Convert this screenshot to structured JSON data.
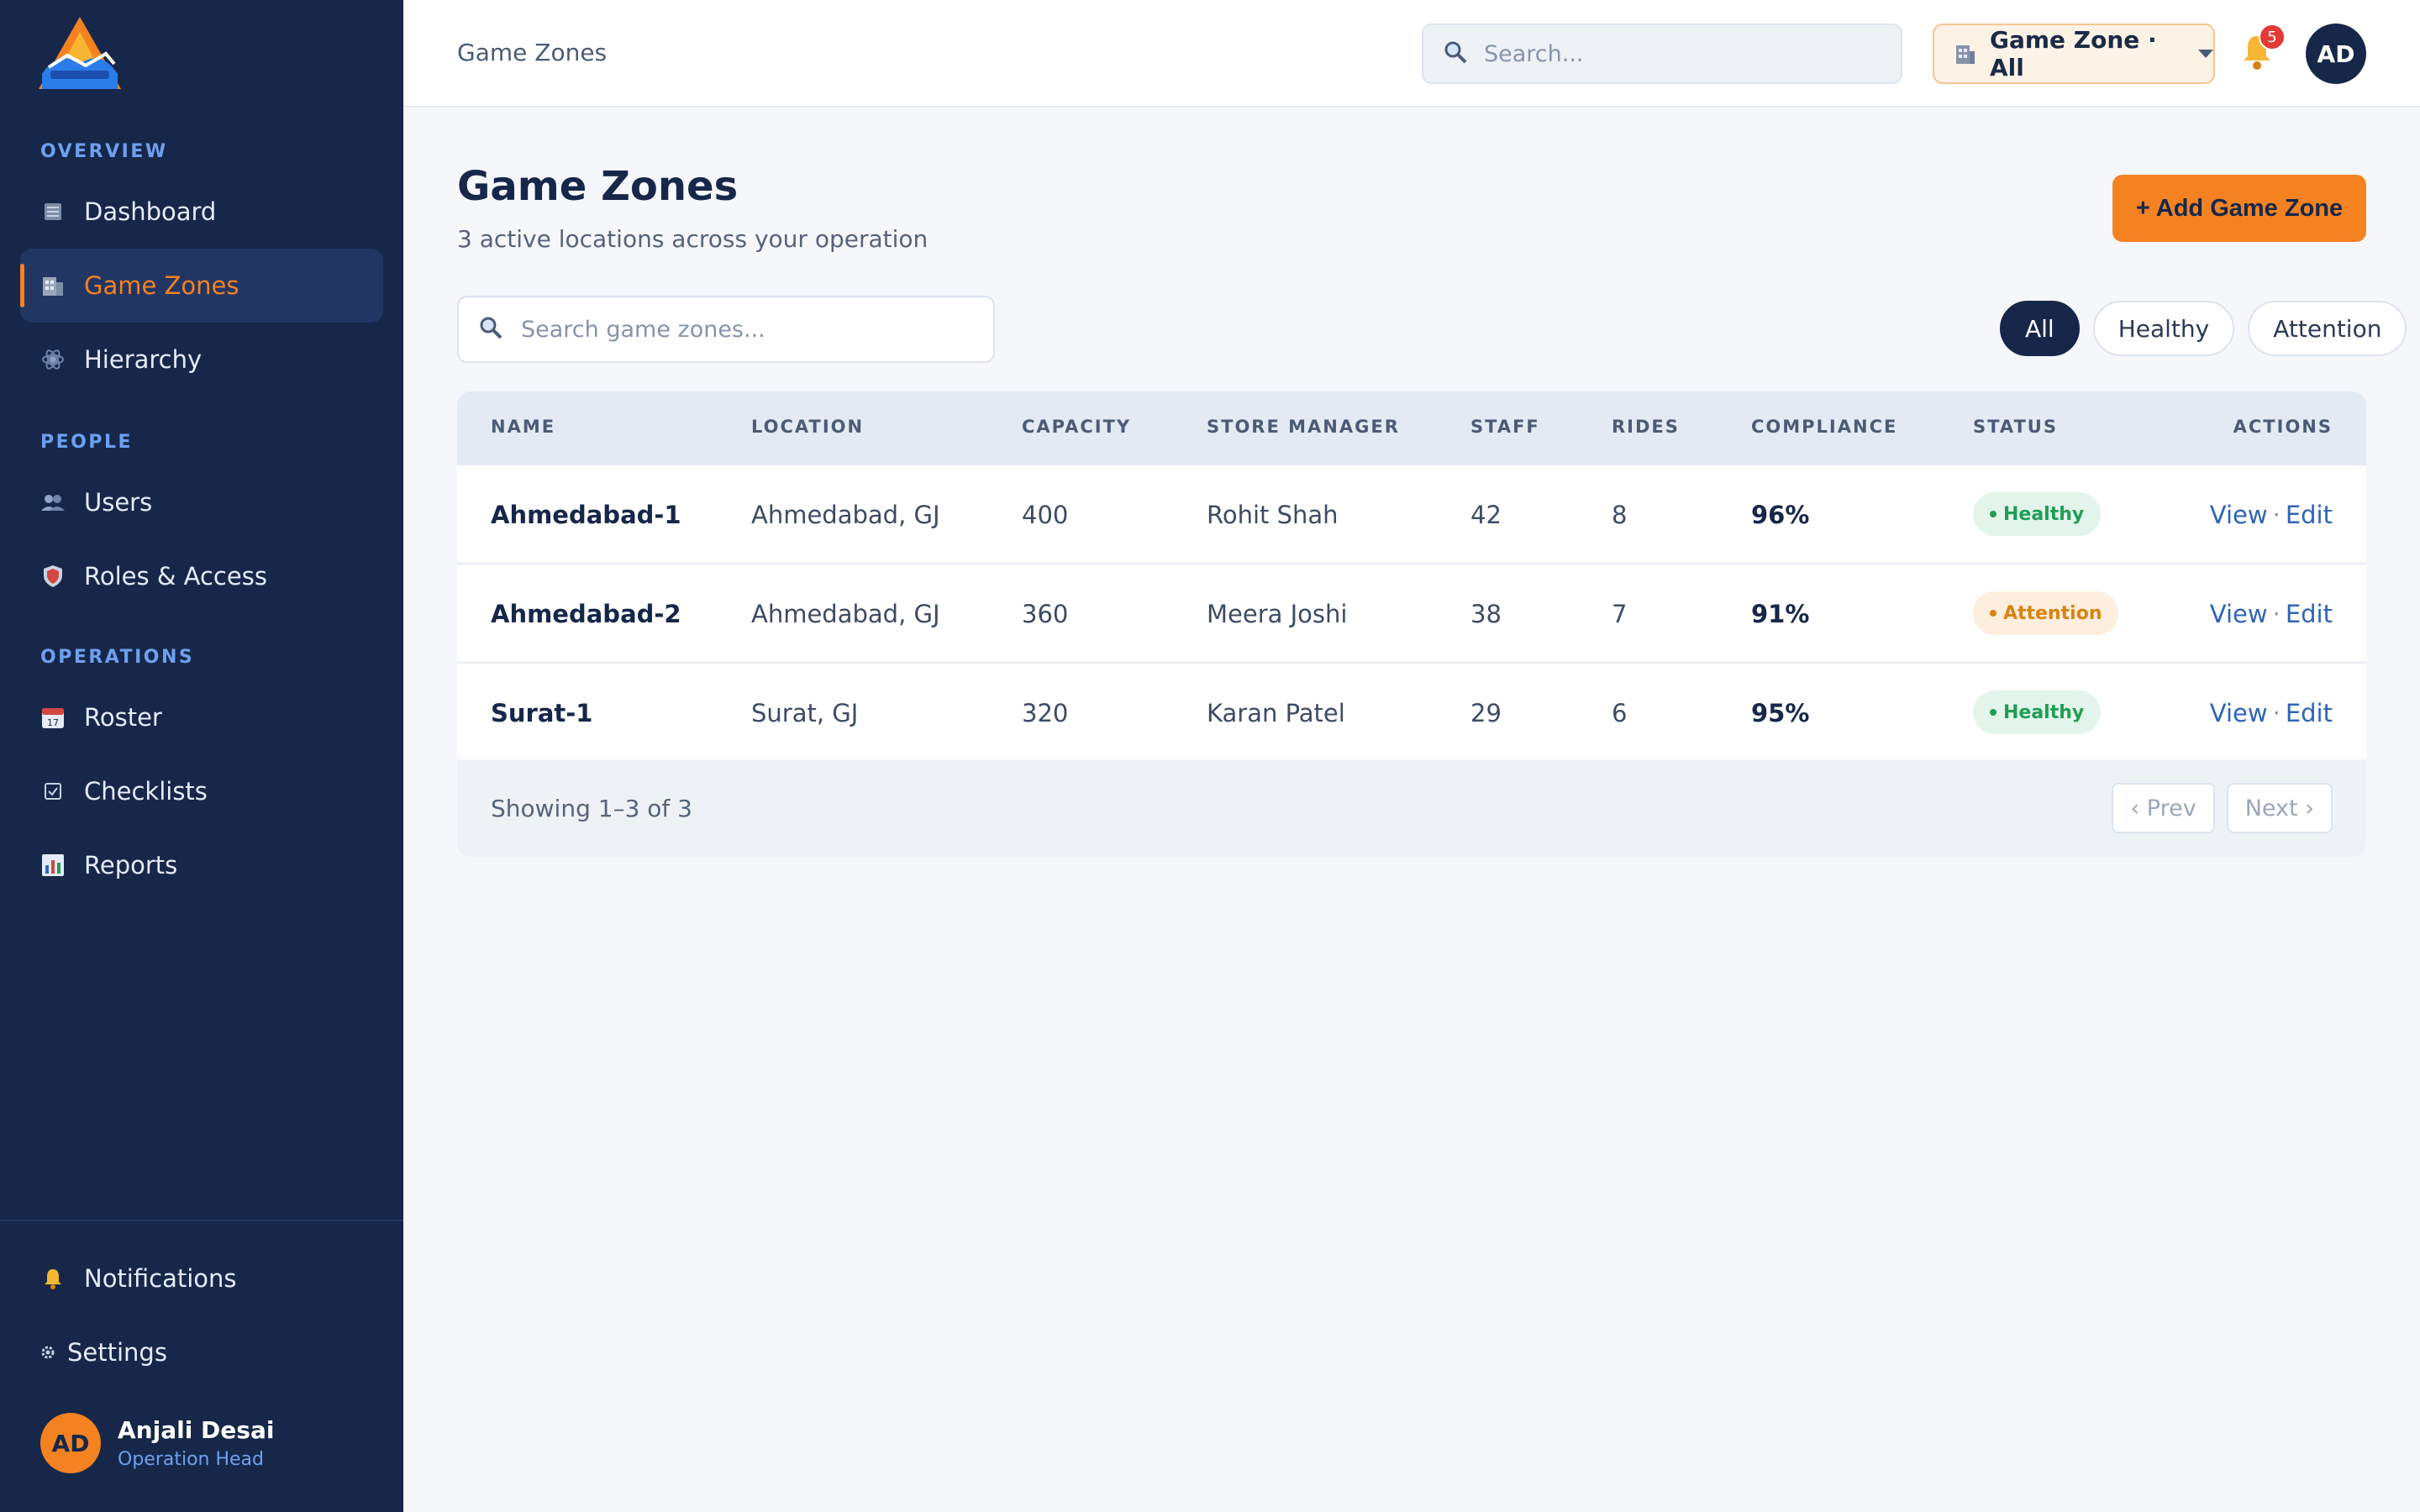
{
  "sidebar": {
    "sections": [
      {
        "label": "OVERVIEW"
      },
      {
        "label": "PEOPLE"
      },
      {
        "label": "OPERATIONS"
      }
    ],
    "items": [
      {
        "label": "Dashboard",
        "icon": "dashboard-icon"
      },
      {
        "label": "Game Zones",
        "icon": "building-icon"
      },
      {
        "label": "Hierarchy",
        "icon": "hierarchy-icon"
      },
      {
        "label": "Users",
        "icon": "users-icon"
      },
      {
        "label": "Roles & Access",
        "icon": "shield-icon"
      },
      {
        "label": "Roster",
        "icon": "calendar-icon"
      },
      {
        "label": "Checklists",
        "icon": "checklist-icon"
      },
      {
        "label": "Reports",
        "icon": "chart-icon"
      }
    ],
    "bottom_items": [
      {
        "label": "Notifications",
        "icon": "bell-icon"
      },
      {
        "label": "Settings",
        "icon": "gear-icon"
      }
    ],
    "user": {
      "initials": "AD",
      "name": "Anjali Desai",
      "role": "Operation Head"
    }
  },
  "topbar": {
    "breadcrumb": "Game Zones",
    "search_placeholder": "Search...",
    "zone_selector": "Game Zone · All",
    "notification_count": "5",
    "avatar_initials": "AD"
  },
  "page": {
    "title": "Game Zones",
    "subtitle": "3 active locations across your operation",
    "add_button": "+ Add Game Zone",
    "table_search_placeholder": "Search game zones...",
    "filters": [
      "All",
      "Healthy",
      "Attention"
    ],
    "active_filter": "All"
  },
  "table": {
    "headers": [
      "NAME",
      "LOCATION",
      "CAPACITY",
      "STORE MANAGER",
      "STAFF",
      "RIDES",
      "COMPLIANCE",
      "STATUS",
      "ACTIONS"
    ],
    "rows": [
      {
        "name": "Ahmedabad-1",
        "location": "Ahmedabad, GJ",
        "capacity": "400",
        "manager": "Rohit Shah",
        "staff": "42",
        "rides": "8",
        "compliance": "96%",
        "status": "Healthy"
      },
      {
        "name": "Ahmedabad-2",
        "location": "Ahmedabad, GJ",
        "capacity": "360",
        "manager": "Meera Joshi",
        "staff": "38",
        "rides": "7",
        "compliance": "91%",
        "status": "Attention"
      },
      {
        "name": "Surat-1",
        "location": "Surat, GJ",
        "capacity": "320",
        "manager": "Karan Patel",
        "staff": "29",
        "rides": "6",
        "compliance": "95%",
        "status": "Healthy"
      }
    ],
    "action_view": "View",
    "action_sep": "·",
    "action_edit": "Edit",
    "showing": "Showing 1–3 of 3",
    "prev": "‹ Prev",
    "next": "Next ›"
  },
  "colors": {
    "sidebar_bg": "#16274a",
    "accent": "#f58220",
    "healthy": "#1e9e55",
    "attention": "#d98310",
    "link": "#2f64b7"
  }
}
